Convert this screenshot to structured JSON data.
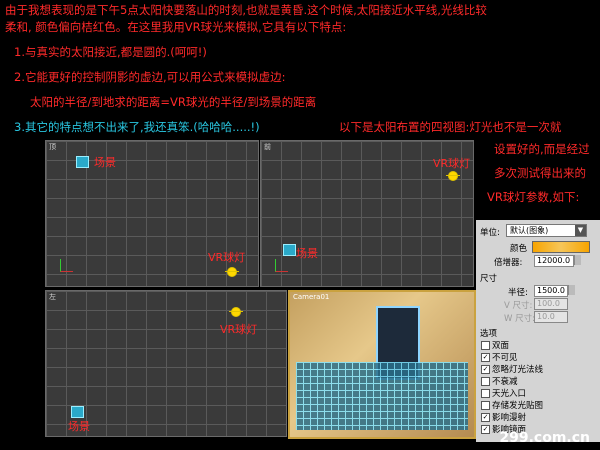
{
  "intro": {
    "line1": "由于我想表现的是下午5点太阳快要落山的时刻,也就是黄昏.这个时候,太阳接近水平线,光线比较",
    "line2": "柔和, 颜色偏向桔红色。在这里我用VR球光来模拟,它具有以下特点:",
    "point1": "1.与真实的太阳接近,都是圆的.(呵呵!)",
    "point2": "2.它能更好的控制阴影的虚边,可以用公式来模拟虚边:",
    "formula": "太阳的半径/到地求的距离=VR球光的半径/到场景的距离",
    "point3": "3.其它的特点想不出来了,我还真笨.(哈哈哈.....!)",
    "point3_tail": "以下是太阳布置的四视图:灯光也不是一次就",
    "right1": "设置好的,而是经过",
    "right2": "多次测试得出来的",
    "right3": "VR球灯参数,如下:"
  },
  "viewports": {
    "top_label": "顶",
    "front_label": "前",
    "left_label": "左",
    "camera_label": "Camera01",
    "scene": "场景",
    "light": "VR球灯"
  },
  "panel": {
    "unit_label": "单位:",
    "unit_value": "默认(图象)",
    "color_label": "颜色",
    "multiplier_label": "倍增器:",
    "multiplier_value": "12000.0",
    "size_section": "尺寸",
    "radius_label": "半径:",
    "radius_value": "1500.0",
    "v_size_label": "V 尺寸:",
    "v_size_value": "100.0",
    "w_size_label": "W 尺寸:",
    "w_size_value": "10.0",
    "options_section": "选项",
    "options": [
      {
        "label": "双面",
        "checked": false
      },
      {
        "label": "不可见",
        "checked": true
      },
      {
        "label": "忽略灯光法线",
        "checked": true
      },
      {
        "label": "不衰减",
        "checked": false
      },
      {
        "label": "天光入口",
        "checked": false
      },
      {
        "label": "存储发光贴图",
        "checked": false
      },
      {
        "label": "影响漫射",
        "checked": true
      },
      {
        "label": "影响镜面",
        "checked": true
      }
    ],
    "accent_color": "#f7a400"
  },
  "watermark": "299.com.cn"
}
